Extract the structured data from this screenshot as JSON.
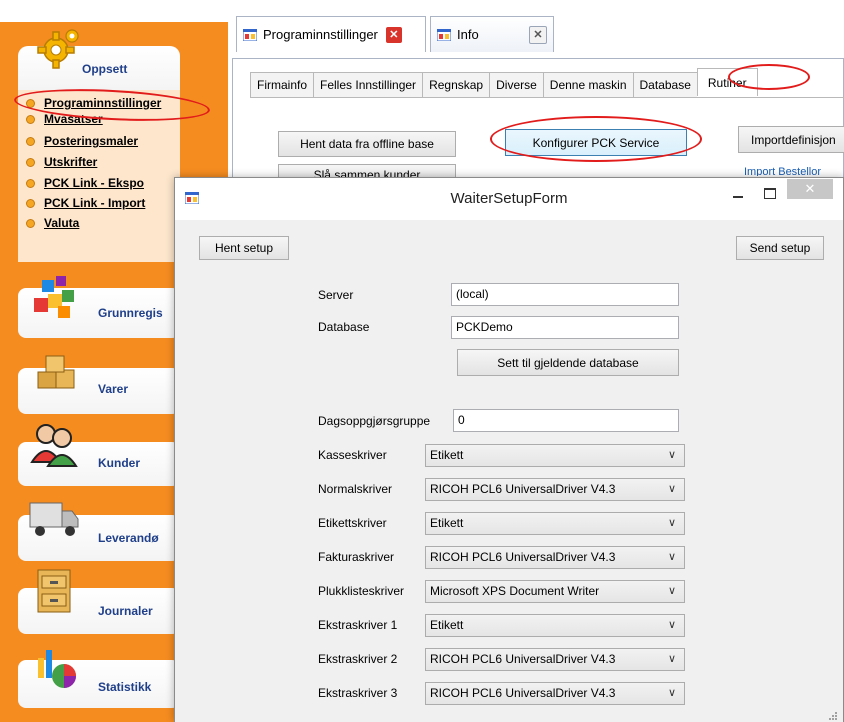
{
  "sidebar": {
    "sections": [
      {
        "label": "Oppsett"
      },
      {
        "label": "Grunnregis"
      },
      {
        "label": "Varer"
      },
      {
        "label": "Kunder"
      },
      {
        "label": "Leverandø"
      },
      {
        "label": "Journaler"
      },
      {
        "label": "Statistikk"
      }
    ],
    "oppsett_items": [
      {
        "label": "Programinnstillinger"
      },
      {
        "label": "Mvasatser"
      },
      {
        "label": "Posteringsmaler"
      },
      {
        "label": "Utskrifter"
      },
      {
        "label": "PCK Link - Ekspo"
      },
      {
        "label": "PCK Link - Import"
      },
      {
        "label": "Valuta"
      }
    ]
  },
  "doc_tabs": [
    {
      "label": "Programinnstillinger",
      "active": true
    },
    {
      "label": "Info",
      "active": false
    }
  ],
  "subtabs": [
    {
      "label": "Firmainfo"
    },
    {
      "label": "Felles Innstillinger"
    },
    {
      "label": "Regnskap"
    },
    {
      "label": "Diverse"
    },
    {
      "label": "Denne maskin"
    },
    {
      "label": "Database"
    },
    {
      "label": "Rutiner"
    }
  ],
  "rutiner": {
    "hent_data_label": "Hent data fra offline base",
    "sla_sammen_label": "Slå sammen kunder",
    "konfigurer_label": "Konfigurer PCK Service",
    "importdef_label": "Importdefinisjon",
    "import_link": "Import Bestellor"
  },
  "dialog": {
    "title": "WaiterSetupForm",
    "hent_setup_label": "Hent setup",
    "send_setup_label": "Send setup",
    "server_label": "Server",
    "server_value": "(local)",
    "database_label": "Database",
    "database_value": "PCKDemo",
    "sett_db_label": "Sett til gjeldende database",
    "dagsoppgjor_label": "Dagsoppgjørsgruppe",
    "dagsoppgjor_value": "0",
    "printers": [
      {
        "label": "Kasseskriver",
        "value": "Etikett"
      },
      {
        "label": "Normalskriver",
        "value": "RICOH PCL6 UniversalDriver V4.3"
      },
      {
        "label": "Etikettskriver",
        "value": "Etikett"
      },
      {
        "label": "Fakturaskriver",
        "value": "RICOH PCL6 UniversalDriver V4.3"
      },
      {
        "label": "Plukklisteskriver",
        "value": "Microsoft XPS Document Writer"
      },
      {
        "label": "Ekstraskriver 1",
        "value": "Etikett"
      },
      {
        "label": "Ekstraskriver 2",
        "value": "RICOH PCL6 UniversalDriver V4.3"
      },
      {
        "label": "Ekstraskriver 3",
        "value": "RICOH PCL6 UniversalDriver V4.3"
      }
    ]
  },
  "icons": {
    "oppsett": "gear-icon",
    "grunnreg": "blocks-icon",
    "varer": "boxes-icon",
    "kunder": "people-icon",
    "leverandor": "truck-icon",
    "journaler": "filing-cabinet-icon",
    "statistikk": "pie-chart-icon"
  },
  "colors": {
    "sidebar_orange": "#f58c20",
    "section_title_blue": "#1f3f8a",
    "annotation_red": "#e21b1b",
    "close_red": "#d9342b"
  }
}
